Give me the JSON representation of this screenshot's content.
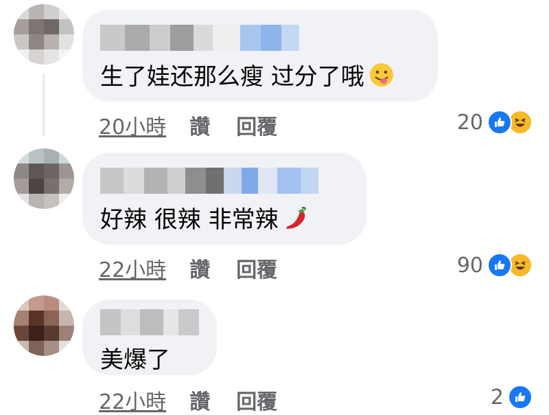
{
  "comments": [
    {
      "text": "生了娃还那么瘦 过分了哦",
      "emoji": "face-with-tongue-emoji",
      "time": "20小時",
      "like_label": "讚",
      "reply_label": "回覆",
      "reaction_count": "20",
      "reactions": [
        "like",
        "haha"
      ]
    },
    {
      "text": "好辣 很辣 非常辣",
      "emoji": "hot-pepper-emoji",
      "time": "22小時",
      "like_label": "讚",
      "reply_label": "回覆",
      "reaction_count": "90",
      "reactions": [
        "like",
        "haha"
      ]
    },
    {
      "text": "美爆了",
      "emoji": "",
      "time": "22小時",
      "like_label": "讚",
      "reply_label": "回覆",
      "reaction_count": "2",
      "reactions": [
        "like"
      ]
    }
  ],
  "colors": {
    "bubble": "#f0f2f5",
    "like_blue": "#1877f2",
    "haha_yellow": "#f7b928",
    "meta_gray": "#65676b"
  }
}
